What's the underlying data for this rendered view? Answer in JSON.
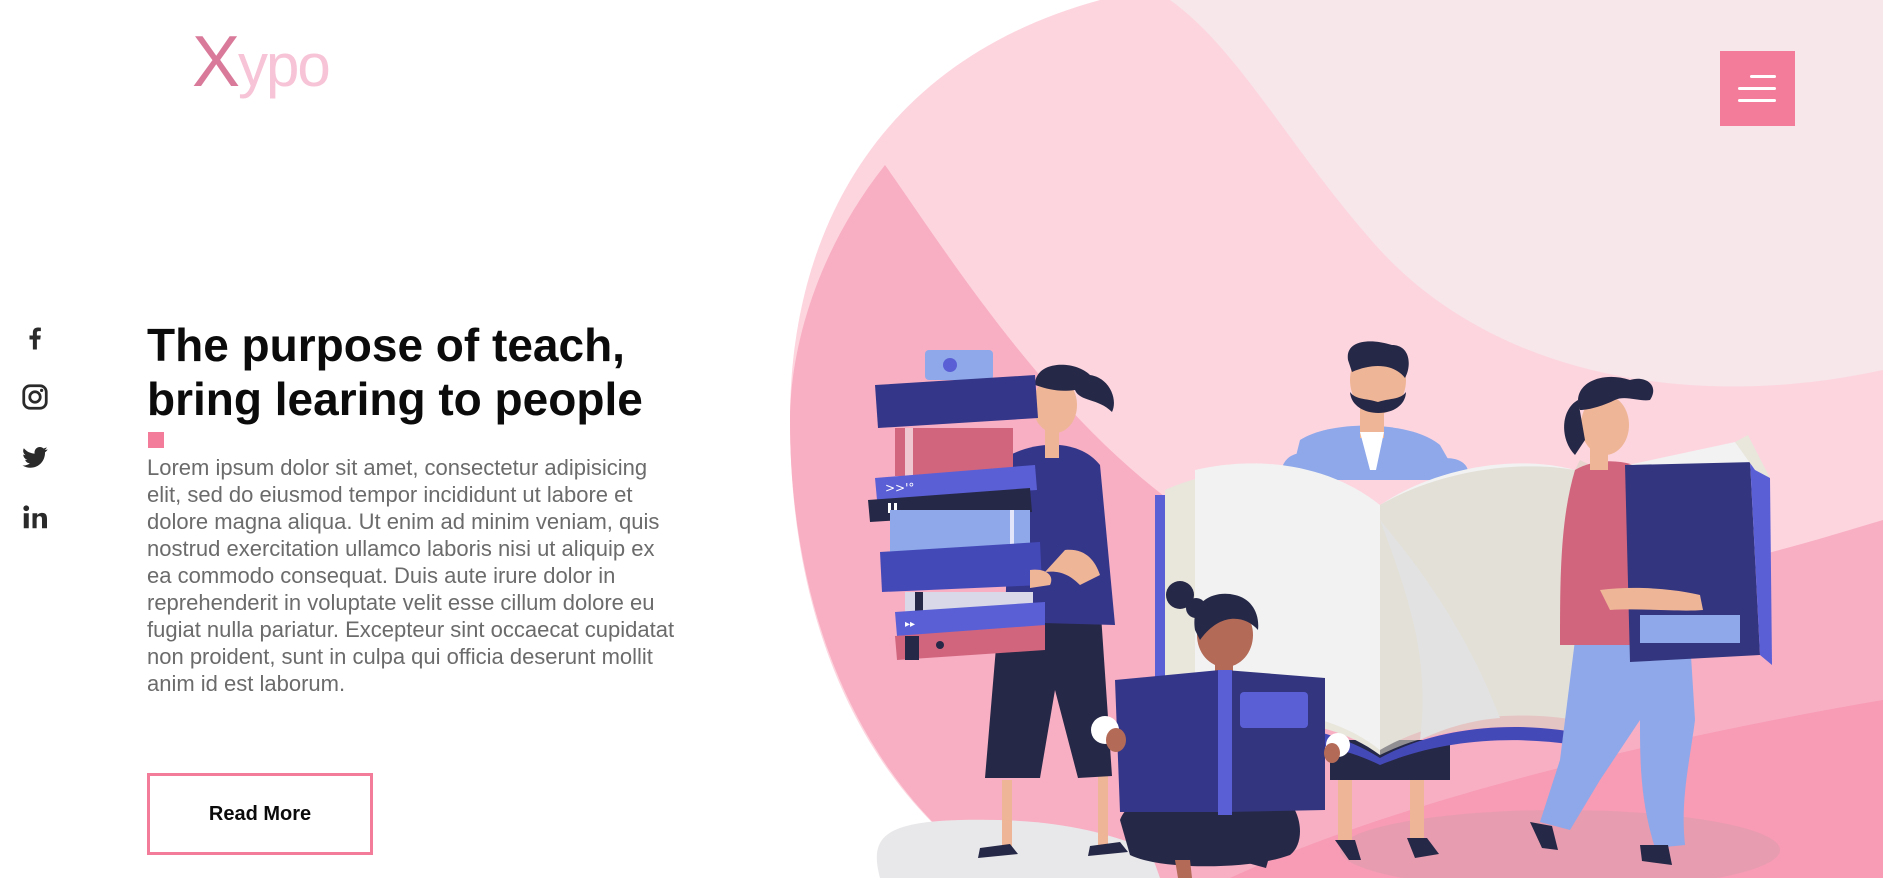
{
  "brand": {
    "logo_x": "X",
    "logo_rest": "ypo"
  },
  "header": {
    "menu_icon": "hamburger-menu-icon"
  },
  "social": [
    {
      "name": "facebook",
      "icon": "facebook-icon"
    },
    {
      "name": "instagram",
      "icon": "instagram-icon"
    },
    {
      "name": "twitter",
      "icon": "twitter-icon"
    },
    {
      "name": "linkedin",
      "icon": "linkedin-icon"
    }
  ],
  "hero": {
    "headline_line1": "The purpose of teach,",
    "headline_line2": "bring learing to people",
    "body": "Lorem ipsum dolor sit amet, consectetur adipisicing elit, sed do eiusmod tempor incididunt ut labore et dolore magna aliqua. Ut enim ad minim veniam, quis nostrud exercitation ullamco laboris nisi ut aliquip ex ea commodo consequat. Duis aute irure dolor in reprehenderit in voluptate velit esse cillum dolore eu fugiat nulla pariatur. Excepteur sint occaecat cupidatat non proident, sunt in culpa qui officia deserunt mollit anim id est laborum.",
    "cta_label": "Read More"
  },
  "colors": {
    "accent": "#f47c9b",
    "blob_light": "#fdd5df",
    "blob_mid": "#f8afc3",
    "logo_x": "#d97a9b",
    "logo_rest": "#f7c3d6",
    "book_navy": "#33357f",
    "book_blue": "#5a5fd6"
  }
}
